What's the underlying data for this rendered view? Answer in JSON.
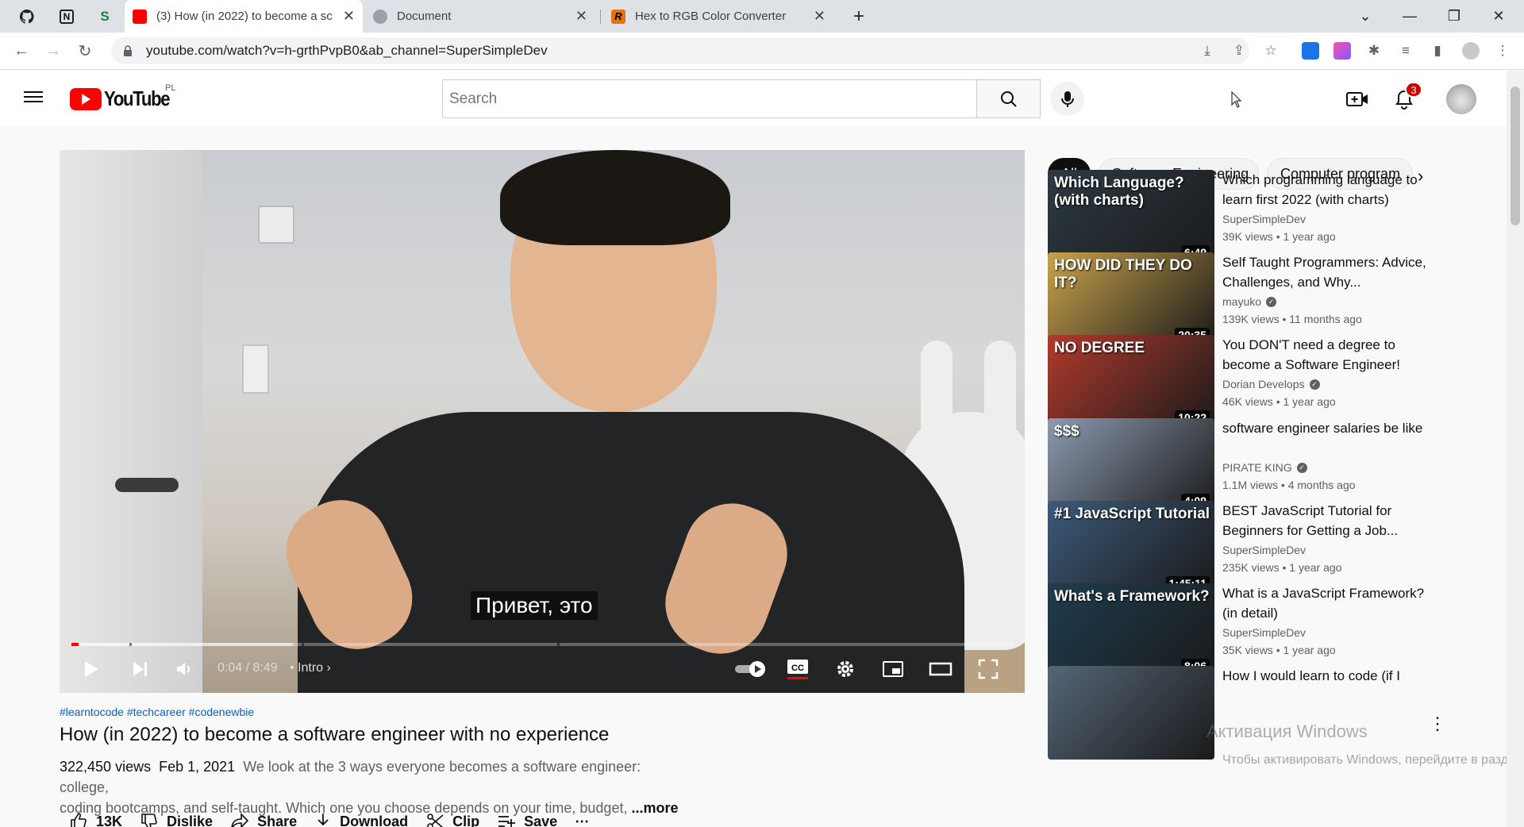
{
  "browser": {
    "tabs": [
      {
        "title": "(3) How (in 2022) to become a sc",
        "active": true
      },
      {
        "title": "Document",
        "active": false
      },
      {
        "title": "Hex to RGB Color Converter",
        "active": false
      }
    ],
    "url": "youtube.com/watch?v=h-grthPvpB0&ab_channel=SuperSimpleDev"
  },
  "youtube": {
    "logo_text": "YouTube",
    "country": "PL",
    "search_placeholder": "Search",
    "notification_count": "3"
  },
  "player": {
    "subtitle": "Привет, это",
    "time": "0:04 / 8:49",
    "chapter": "Intro",
    "played_fraction": 0.008,
    "loaded_fraction": 0.235
  },
  "video": {
    "hashtags": "#learntocode #techcareer #codenewbie",
    "title": "How (in 2022) to become a software engineer with no experience",
    "views": "322,450 views",
    "date": "Feb 1, 2021",
    "description_line1": "We look at the 3 ways everyone becomes a software engineer: college,",
    "description_line2": "coding bootcamps, and self-taught. Which one you choose depends on your time, budget,",
    "more": "...more",
    "actions": {
      "likes": "13K",
      "dislike": "Dislike",
      "share": "Share",
      "download": "Download",
      "clip": "Clip",
      "save": "Save"
    }
  },
  "chips": [
    "All",
    "Software Engineering",
    "Computer program"
  ],
  "recommendations": [
    {
      "title": "Which programming language to learn first 2022 (with charts)",
      "channel": "SuperSimpleDev",
      "verified": false,
      "meta": "39K views • 1 year ago",
      "duration": "6:49",
      "thumb_text": "Which Language? (with charts)",
      "color": "#2d3a44"
    },
    {
      "title": "Self Taught Programmers: Advice, Challenges, and Why...",
      "channel": "mayuko",
      "verified": true,
      "meta": "139K views • 11 months ago",
      "duration": "20:35",
      "thumb_text": "HOW DID THEY DO IT?",
      "color": "#c9a24b"
    },
    {
      "title": "You DON'T need a degree to become a Software Engineer!",
      "channel": "Dorian Develops",
      "verified": true,
      "meta": "46K views • 1 year ago",
      "duration": "10:22",
      "thumb_text": "NO DEGREE",
      "color": "#b23a2c"
    },
    {
      "title": "software engineer salaries be like",
      "channel": "PIRATE KING",
      "verified": true,
      "meta": "1.1M views • 4 months ago",
      "duration": "4:09",
      "thumb_text": "$$$",
      "color": "#8c9bb0"
    },
    {
      "title": "BEST JavaScript Tutorial for Beginners for Getting a Job...",
      "channel": "SuperSimpleDev",
      "verified": false,
      "meta": "235K views • 1 year ago",
      "duration": "1:45:11",
      "thumb_text": "#1 JavaScript Tutorial",
      "color": "#3c5a7a"
    },
    {
      "title": "What is a JavaScript Framework? (in detail)",
      "channel": "SuperSimpleDev",
      "verified": false,
      "meta": "35K views • 1 year ago",
      "duration": "8:06",
      "thumb_text": "What's a Framework?",
      "color": "#1f3d4f"
    },
    {
      "title": "How I would learn to code (if I",
      "channel": "",
      "verified": false,
      "meta": "",
      "duration": "",
      "thumb_text": "",
      "color": "#556677"
    }
  ],
  "watermark": {
    "line1": "Активация Windows",
    "line2": "Чтобы активировать Windows, перейдите в раздел «Параметры»."
  }
}
